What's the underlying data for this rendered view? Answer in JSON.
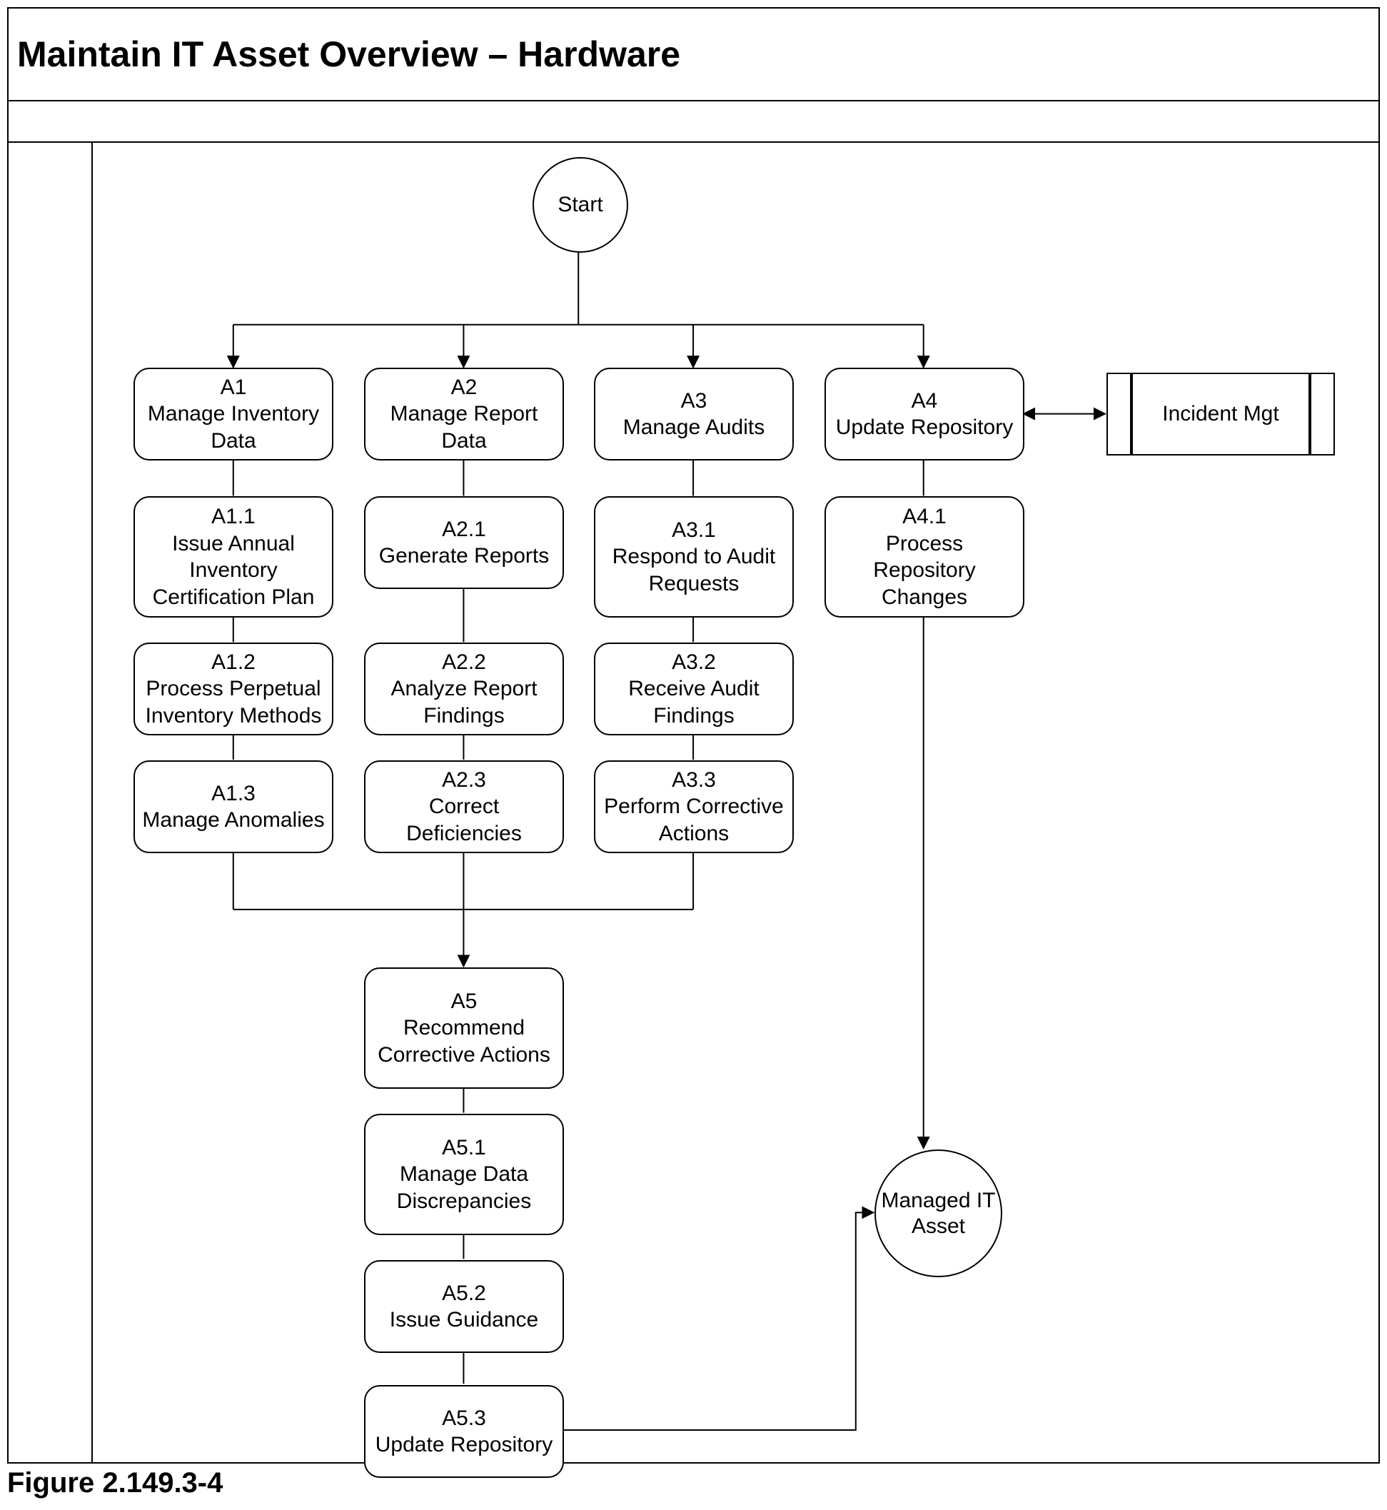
{
  "title": "Maintain IT Asset Overview – Hardware",
  "caption": "Figure 2.149.3-4",
  "start": "Start",
  "end": "Managed IT Asset",
  "incident": "Incident Mgt",
  "a1": {
    "id": "A1",
    "label": "Manage Inventory Data"
  },
  "a11": {
    "id": "A1.1",
    "label": "Issue Annual Inventory Certification Plan"
  },
  "a12": {
    "id": "A1.2",
    "label": "Process Perpetual Inventory Methods"
  },
  "a13": {
    "id": "A1.3",
    "label": "Manage Anomalies"
  },
  "a2": {
    "id": "A2",
    "label": "Manage Report Data"
  },
  "a21": {
    "id": "A2.1",
    "label": "Generate Reports"
  },
  "a22": {
    "id": "A2.2",
    "label": "Analyze Report Findings"
  },
  "a23": {
    "id": "A2.3",
    "label": "Correct Deficiencies"
  },
  "a3": {
    "id": "A3",
    "label": "Manage Audits"
  },
  "a31": {
    "id": "A3.1",
    "label": "Respond to Audit Requests"
  },
  "a32": {
    "id": "A3.2",
    "label": "Receive Audit Findings"
  },
  "a33": {
    "id": "A3.3",
    "label": "Perform Corrective Actions"
  },
  "a4": {
    "id": "A4",
    "label": "Update Repository"
  },
  "a41": {
    "id": "A4.1",
    "label": "Process Repository Changes"
  },
  "a5": {
    "id": "A5",
    "label": "Recommend Corrective Actions"
  },
  "a51": {
    "id": "A5.1",
    "label": "Manage Data Discrepancies"
  },
  "a52": {
    "id": "A5.2",
    "label": "Issue Guidance"
  },
  "a53": {
    "id": "A5.3",
    "label": "Update Repository"
  }
}
